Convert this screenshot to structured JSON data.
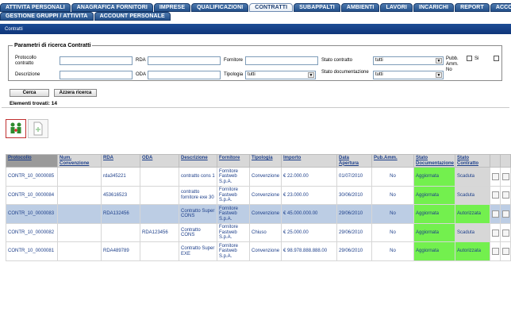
{
  "tabs_row1": [
    "ATTIVITA PERSONALI",
    "ANAGRAFICA FORNITORI",
    "IMPRESE",
    "QUALIFICAZIONI",
    "CONTRATTI",
    "SUBAPPALTI",
    "AMBIENTI",
    "LAVORI",
    "INCARICHI",
    "REPORT",
    "ACCOUNT"
  ],
  "tabs_row2": [
    "GESTIONE GRUPPI / ATTIVITA",
    "ACCOUNT PERSONALE"
  ],
  "active_tab": "CONTRATTI",
  "breadcrumb": "Contratti",
  "search": {
    "legend": "Parametri di ricerca Contratti",
    "protocollo_label": "Protocollo contratto",
    "rda_label": "RDA",
    "fornitore_label": "Fornitore",
    "stato_contratto_label": "Stato contratto",
    "stato_contratto_value": "tutti",
    "pubb_amm_label": "Pubb. Amm.",
    "si_label": "Si",
    "no_label": "No",
    "descrizione_label": "Descrizione",
    "oda_label": "ODA",
    "tipologia_label": "Tipologia",
    "tipologia_value": "tutti",
    "stato_doc_label": "Stato documentazione",
    "stato_doc_value": "tutti",
    "cerca_label": "Cerca",
    "azzera_label": "Azzera ricerca",
    "found_text": "Elementi trovati: 14"
  },
  "table": {
    "headers": [
      "Protocollo",
      "Num. Convenzione",
      "RDA",
      "ODA",
      "Descrizione",
      "Fornitore",
      "Tipologia",
      "Importo",
      "Data Apertura",
      "Pub.Amm.",
      "Stato Documentazione",
      "Stato Contratto"
    ],
    "rows": [
      {
        "protocollo": "CONTR_10_0000085",
        "num": "",
        "rda": "rda345221",
        "oda": "",
        "descrizione": "contratto cons 1",
        "fornitore": "Fornitore Fastweb S.p.A.",
        "tipologia": "Convenzione",
        "importo": "€ 22.000.00",
        "data": "01/07/2010",
        "pub": "No",
        "stato_doc": "Aggiornata",
        "stato_contr": "Scaduta"
      },
      {
        "protocollo": "CONTR_10_0000084",
        "num": "",
        "rda": "453616523",
        "oda": "",
        "descrizione": "contratto fornitore exe 30",
        "fornitore": "Fornitore Fastweb S.p.A.",
        "tipologia": "Convenzione",
        "importo": "€ 23.000.00",
        "data": "30/06/2010",
        "pub": "No",
        "stato_doc": "Aggiornata",
        "stato_contr": "Scaduta"
      },
      {
        "protocollo": "CONTR_10_0000083",
        "num": "",
        "rda": "RDA132456",
        "oda": "",
        "descrizione": "Contratto Super CONS",
        "fornitore": "Fornitore Fastweb S.p.A.",
        "tipologia": "Convenzione",
        "importo": "€ 45.000.000.00",
        "data": "29/06/2010",
        "pub": "No",
        "stato_doc": "Aggiornata",
        "stato_contr": "Autorizzata"
      },
      {
        "protocollo": "CONTR_10_0000082",
        "num": "",
        "rda": "",
        "oda": "RDA123456",
        "descrizione": "Contratto CONS",
        "fornitore": "Fornitore Fastweb S.p.A.",
        "tipologia": "Chiuso",
        "importo": "€ 25.000.00",
        "data": "29/06/2010",
        "pub": "No",
        "stato_doc": "Aggiornata",
        "stato_contr": "Scaduta"
      },
      {
        "protocollo": "CONTR_10_0000081",
        "num": "",
        "rda": "RDA489789",
        "oda": "",
        "descrizione": "Contratto Super EXE",
        "fornitore": "Fornitore Fastweb S.p.A.",
        "tipologia": "Convenzione",
        "importo": "€ 98.978.888.888.00",
        "data": "29/06/2010",
        "pub": "No",
        "stato_doc": "Aggiornata",
        "stato_contr": "Autorizzata"
      }
    ]
  },
  "colors": {
    "tab_blue": "#23508a",
    "title_blue": "#1d4d95",
    "status_green": "#73f04e",
    "selected_row": "#bccde4"
  }
}
